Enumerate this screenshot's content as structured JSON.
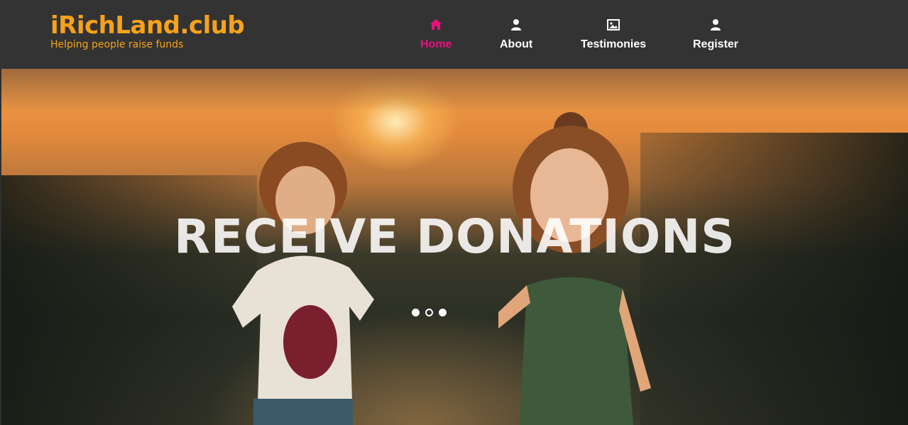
{
  "brand": {
    "title": "iRichLand.club",
    "tagline": "Helping people raise funds",
    "color": "#f7a21b"
  },
  "nav": {
    "active_color": "#e8117f",
    "items": [
      {
        "label": "Home",
        "icon": "home-icon",
        "active": true
      },
      {
        "label": "About",
        "icon": "user-icon",
        "active": false
      },
      {
        "label": "Testimonies",
        "icon": "image-icon",
        "active": false
      },
      {
        "label": "Register",
        "icon": "user-icon",
        "active": false
      }
    ]
  },
  "hero": {
    "headline": "RECEIVE DONATIONS",
    "slide_count": 3,
    "active_slide": 2
  }
}
